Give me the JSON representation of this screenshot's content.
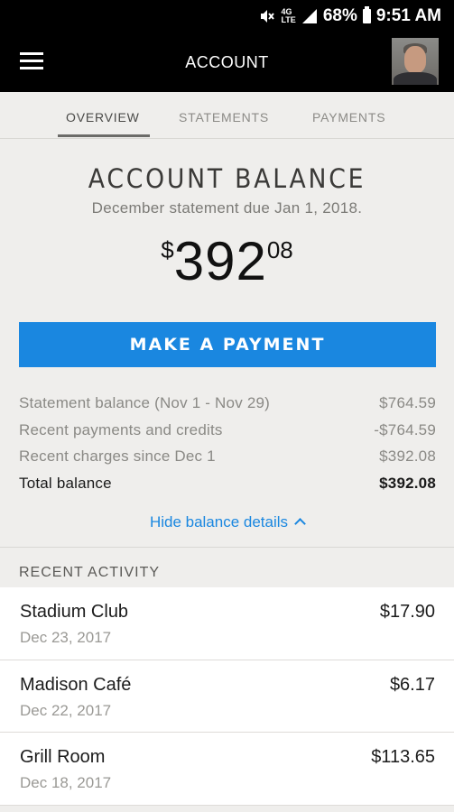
{
  "status_bar": {
    "battery": "68%",
    "time": "9:51 AM",
    "network": "4G LTE",
    "icons": [
      "mute-icon",
      "lte-icon",
      "signal-icon",
      "battery-icon"
    ]
  },
  "app_bar": {
    "title": "ACCOUNT",
    "menu_icon": "hamburger-menu-icon",
    "avatar": "user-avatar"
  },
  "tabs": [
    {
      "label": "OVERVIEW",
      "active": true
    },
    {
      "label": "STATEMENTS",
      "active": false
    },
    {
      "label": "PAYMENTS",
      "active": false
    }
  ],
  "balance": {
    "heading": "ACCOUNT BALANCE",
    "subtitle": "December statement due Jan 1, 2018.",
    "currency": "$",
    "whole": "392",
    "cents": "08",
    "pay_button": "MAKE A PAYMENT"
  },
  "details": [
    {
      "label": "Statement balance (Nov 1 - Nov 29)",
      "value": "$764.59"
    },
    {
      "label": "Recent payments and credits",
      "value": "-$764.59"
    },
    {
      "label": "Recent charges since Dec 1",
      "value": "$392.08"
    },
    {
      "label": "Total balance",
      "value": "$392.08"
    }
  ],
  "hide_details": "Hide balance details",
  "recent_activity": {
    "label": "RECENT ACTIVITY",
    "items": [
      {
        "name": "Stadium Club",
        "date": "Dec 23, 2017",
        "amount": "$17.90"
      },
      {
        "name": "Madison Café",
        "date": "Dec 22, 2017",
        "amount": "$6.17"
      },
      {
        "name": "Grill Room",
        "date": "Dec 18, 2017",
        "amount": "$113.65"
      }
    ]
  },
  "colors": {
    "accent": "#1a87e0",
    "bar": "#000000",
    "background": "#efeeec"
  }
}
